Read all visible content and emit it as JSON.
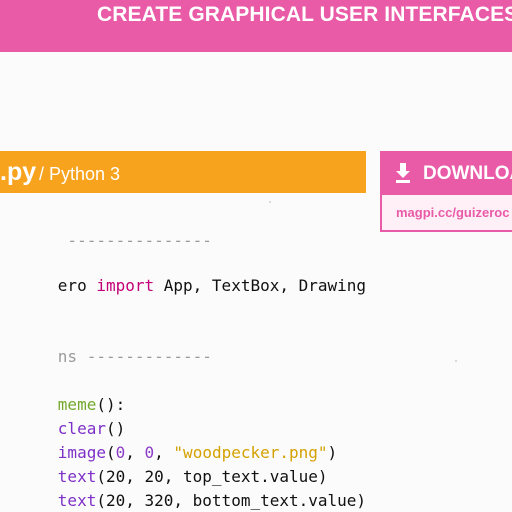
{
  "banner": {
    "text": "CREATE GRAPHICAL USER INTERFACES WITH",
    "color": "#e95aa7"
  },
  "code_header": {
    "filename": ".py",
    "language": "/ Python 3",
    "color": "#f7a31e"
  },
  "download": {
    "title": "DOWNLOA",
    "link": "magpi.cc/guizeroc",
    "icon": "download-arrow-icon",
    "color": "#e95aa7"
  },
  "code_lines": [
    {
      "parts": [
        {
          "text": " ---------------",
          "type": "comment"
        }
      ]
    },
    {
      "parts": [
        {
          "text": "ero ",
          "type": "plain"
        },
        {
          "text": "import",
          "type": "keyword"
        },
        {
          "text": " App, TextBox, Drawing",
          "type": "plain"
        }
      ]
    },
    {
      "parts": [
        {
          "text": "ns -------------",
          "type": "comment"
        }
      ]
    },
    {
      "parts": [
        {
          "text": "meme",
          "type": "func-green"
        },
        {
          "text": "():",
          "type": "plain"
        }
      ]
    },
    {
      "parts": [
        {
          "text": "clear",
          "type": "func"
        },
        {
          "text": "()",
          "type": "plain"
        }
      ]
    },
    {
      "parts": [
        {
          "text": "image",
          "type": "func"
        },
        {
          "text": "(",
          "type": "plain"
        },
        {
          "text": "0",
          "type": "number"
        },
        {
          "text": ", ",
          "type": "plain"
        },
        {
          "text": "0",
          "type": "number"
        },
        {
          "text": ", ",
          "type": "plain"
        },
        {
          "text": "\"woodpecker.png\"",
          "type": "string"
        },
        {
          "text": ")",
          "type": "plain"
        }
      ]
    },
    {
      "parts": [
        {
          "text": "text",
          "type": "func"
        },
        {
          "text": "(20, 20, top_text.value)",
          "type": "plain"
        }
      ]
    },
    {
      "parts": [
        {
          "text": "text",
          "type": "func"
        },
        {
          "text": "(20, 320, bottom_text.value)",
          "type": "plain"
        }
      ]
    }
  ]
}
